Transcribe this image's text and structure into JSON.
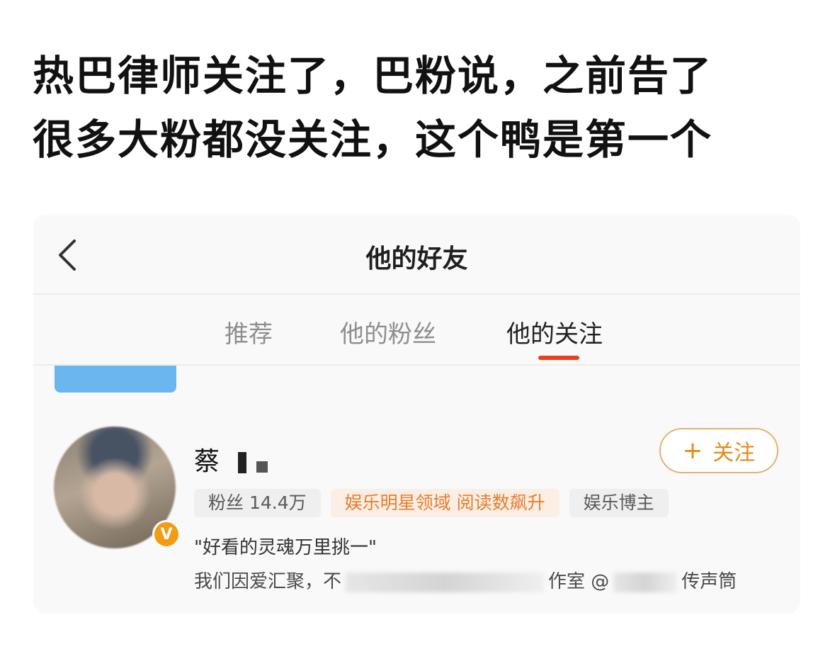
{
  "caption": {
    "line1": "热巴律师关注了，巴粉说，之前告了",
    "line2": "很多大粉都没关注，这个鸭是第一个"
  },
  "navbar": {
    "title": "他的好友"
  },
  "tabs": [
    {
      "label": "推荐",
      "active": false
    },
    {
      "label": "他的粉丝",
      "active": false
    },
    {
      "label": "他的关注",
      "active": true
    }
  ],
  "user": {
    "name_visible": "蔡",
    "follow_label": "关注",
    "tags": [
      "粉丝 14.4万",
      "娱乐明星领域 阅读数飙升",
      "娱乐博主"
    ],
    "bio": "\"好看的灵魂万里挑一\"",
    "desc_start": "我们因爱汇聚，不",
    "desc_mid": "作室 @",
    "desc_end": "传声筒",
    "badge_letter": "V"
  },
  "colors": {
    "accent": "#e8401c",
    "follow": "#e58a16",
    "verified": "#f39b12"
  }
}
